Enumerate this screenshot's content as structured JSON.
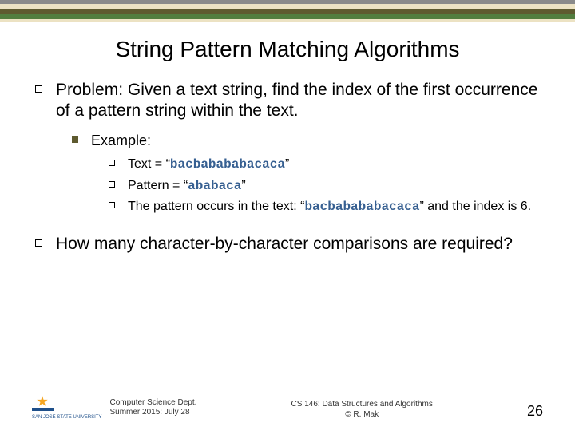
{
  "title": "String Pattern Matching Algorithms",
  "bullets": {
    "b1": "Problem: Given a text string, find the index of the first occurrence of a pattern string within the text.",
    "example_label": "Example:",
    "ex1_pre": "Text = “",
    "ex1_mono": "bacbabababacaca",
    "ex1_post": "”",
    "ex2_pre": "Pattern = “",
    "ex2_mono": "ababaca",
    "ex2_post": "”",
    "ex3_pre": "The pattern occurs in the text: “",
    "ex3_mono": "bacbabababacaca",
    "ex3_post": "” and the index is 6.",
    "b2": "How many character-by-character comparisons are required?"
  },
  "footer": {
    "logo_label": "SAN JOSE STATE UNIVERSITY",
    "dept_line1": "Computer Science Dept.",
    "dept_line2": "Summer 2015: July 28",
    "course_line1": "CS 146: Data Structures and Algorithms",
    "course_line2": "© R. Mak",
    "page": "26"
  }
}
